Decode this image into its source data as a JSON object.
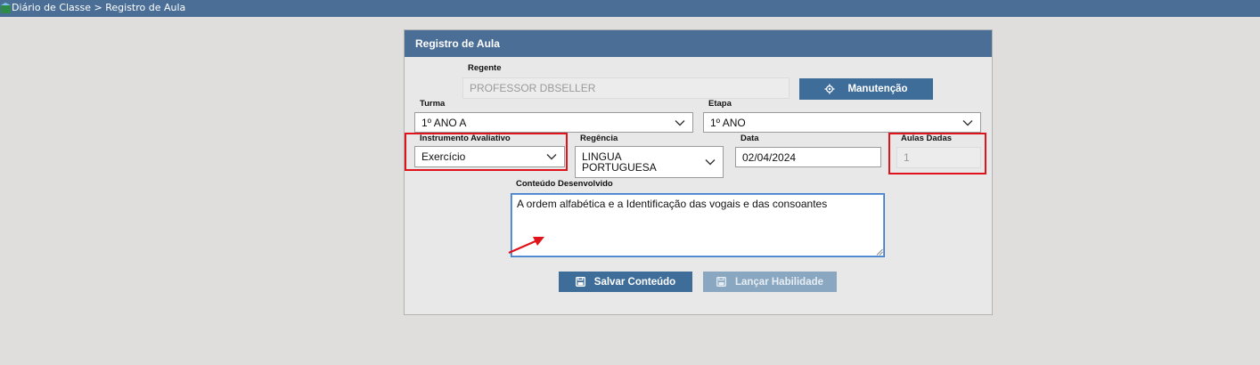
{
  "breadcrumb": "Diário de Classe > Registro de Aula",
  "panel": {
    "title": "Registro de Aula",
    "regente": {
      "label": "Regente",
      "value": "PROFESSOR DBSELLER"
    },
    "manutencao_label": "Manutenção",
    "turma": {
      "label": "Turma",
      "value": "1º ANO A"
    },
    "etapa": {
      "label": "Etapa",
      "value": "1º ANO"
    },
    "instrumento": {
      "label": "Instrumento Avaliativo",
      "value": "Exercício"
    },
    "regencia": {
      "label": "Regência",
      "value_line1": "LINGUA",
      "value_line2": "PORTUGUESA"
    },
    "data": {
      "label": "Data",
      "value": "02/04/2024"
    },
    "aulas": {
      "label": "Aulas Dadas",
      "value": "1"
    },
    "conteudo": {
      "label": "Conteúdo Desenvolvido",
      "value": "A ordem alfabética e  a Identificação  das vogais  e das consoantes"
    },
    "salvar_label": "Salvar Conteúdo",
    "lancar_label": "Lançar Habilidade"
  },
  "colors": {
    "header": "#4a6e96",
    "button": "#3e6d9a",
    "highlight": "#e0121a"
  }
}
